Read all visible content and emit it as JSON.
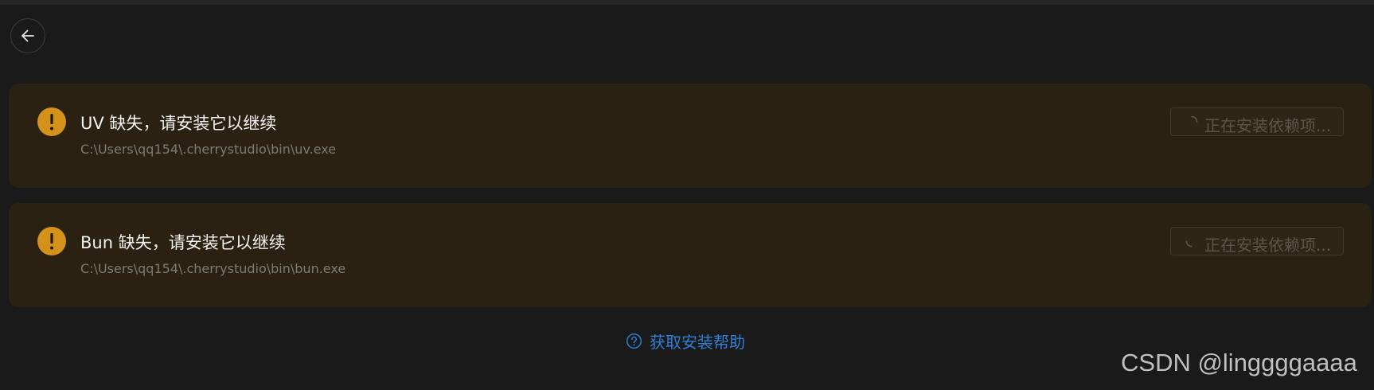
{
  "back": {
    "icon": "arrow-left-icon"
  },
  "dependencies": [
    {
      "title": "UV 缺失，请安装它以继续",
      "path": "C:\\Users\\qq154\\.cherrystudio\\bin\\uv.exe",
      "button_label": "正在安装依赖项..."
    },
    {
      "title": "Bun 缺失，请安装它以继续",
      "path": "C:\\Users\\qq154\\.cherrystudio\\bin\\bun.exe",
      "button_label": "正在安装依赖项..."
    }
  ],
  "help": {
    "label": "获取安装帮助",
    "icon": "question-circle-icon"
  },
  "watermark": "CSDN @linggggaaaa",
  "colors": {
    "background": "#1a1a1a",
    "warning_card": "#2b2112",
    "warning_icon": "#d4921b",
    "link": "#2f7ed6"
  }
}
